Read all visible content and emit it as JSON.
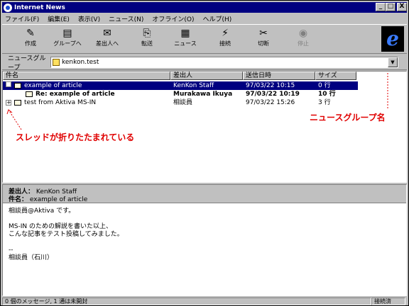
{
  "window": {
    "title": "Internet News",
    "controls": {
      "minimize": "_",
      "maximize": "□",
      "close": "X"
    }
  },
  "menu": [
    "ファイル(F)",
    "編集(E)",
    "表示(V)",
    "ニュース(N)",
    "オフライン(O)",
    "ヘルプ(H)"
  ],
  "toolbar": [
    {
      "label": "作成",
      "icon": "new-message-icon",
      "glyph": "✎"
    },
    {
      "label": "グループへ",
      "icon": "reply-group-icon",
      "glyph": "▤"
    },
    {
      "label": "差出人へ",
      "icon": "reply-author-icon",
      "glyph": "✉"
    },
    {
      "label": "転送",
      "icon": "forward-icon",
      "glyph": "⎘"
    },
    {
      "label": "ニュース",
      "icon": "newsgroups-icon",
      "glyph": "▦"
    },
    {
      "label": "接続",
      "icon": "connect-icon",
      "glyph": "⚡"
    },
    {
      "label": "切断",
      "icon": "disconnect-icon",
      "glyph": "✂"
    },
    {
      "label": "停止",
      "icon": "stop-icon",
      "glyph": "◉"
    }
  ],
  "newsgroup_bar": {
    "label": "ニュースグループ",
    "value": "kenkon.test",
    "drop": "▼"
  },
  "columns": [
    "件名",
    "差出人",
    "送信日時",
    "サイズ"
  ],
  "messages": [
    {
      "expander": "",
      "subject": "example of article",
      "from": "KenKon Staff",
      "date": "97/03/22 10:15",
      "size": "0 行"
    },
    {
      "expander": "",
      "subject": "Re: example of article",
      "from": "Murakawa Ikuya",
      "date": "97/03/22 10:19",
      "size": "10 行"
    },
    {
      "expander": "+",
      "subject": "test from Aktiva MS-IN",
      "from": "相談員",
      "date": "97/03/22 15:26",
      "size": "3 行"
    }
  ],
  "annotations": {
    "thread_folded": "スレッドが折りたたまれている",
    "newsgroup_name": "ニュースグループ名"
  },
  "preview": {
    "from_label": "差出人：",
    "from_value": "KenKon Staff",
    "subject_label": "件名：",
    "subject_value": "example of article",
    "body": "相談員@Aktiva です。\n\nMS-IN のための解説を書いた以上、\nこんな記事をテスト投稿してみました。\n\n--\n相談員（石川）"
  },
  "status": {
    "messages": "0 個のメッセージ, 1 通は未開封",
    "state": "接続済"
  }
}
